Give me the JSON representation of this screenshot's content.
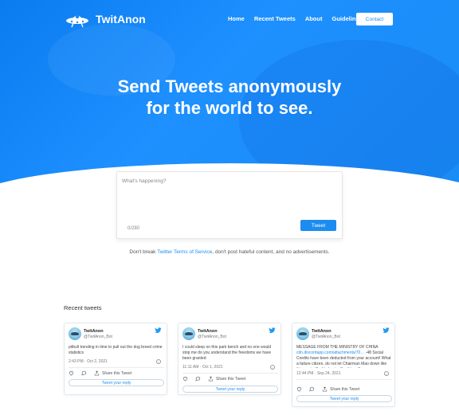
{
  "brand": {
    "name": "TwitAnon",
    "logo_icon": "spaceship-logo-icon"
  },
  "nav": {
    "items": [
      {
        "label": "Home"
      },
      {
        "label": "Recent Tweets"
      },
      {
        "label": "About"
      },
      {
        "label": "Guidelines"
      }
    ],
    "contact_label": "Contact"
  },
  "hero": {
    "line1": "Send Tweets anonymously",
    "line2": "for the world to see."
  },
  "compose": {
    "placeholder": "What's happening?",
    "counter": "0/280",
    "tweet_label": "Tweet"
  },
  "disclaimer": {
    "before": "Don't break ",
    "link": "Twitter Terms of Service",
    "after": ", don't post hateful content, and no advertisements."
  },
  "recent": {
    "title": "Recent tweets",
    "tweets": [
      {
        "name": "TwitAnon",
        "handle": "@TwitAnon_Bot",
        "text": "pitbull trending in time to pull out the dog breed crime statistics",
        "time": "2:43 PM · Oct 2, 2021",
        "share_label": "Share this Tweet",
        "reply_label": "Tweet your reply"
      },
      {
        "name": "TwitAnon",
        "handle": "@TwitAnon_Bot",
        "text": "I could sleep on this park bench and no one would stop me do you understand the freedoms we have been granted",
        "time": "11:11 AM · Oct 1, 2021",
        "share_label": "Share this Tweet",
        "reply_label": "Tweet your reply"
      },
      {
        "name": "TwitAnon",
        "handle": "@TwitAnon_Bot",
        "text_before": "MESSAGE FROM THE MINISTRY OF CHINA ",
        "text_link": "cdn.discordapp.com/attachments/70…",
        "text_after": " -48 Social Credits have been deducted from your account! What a failure citizen, do not let Chairman Mao down like this again. Bad behavior like this will n",
        "time": "12:44 PM · Sep 24, 2021",
        "share_label": "Share this Tweet",
        "reply_label": "Tweet your reply"
      }
    ]
  },
  "colors": {
    "accent": "#1d8cf0",
    "hero_start": "#0a7cf0",
    "hero_end": "#1e90ff"
  }
}
